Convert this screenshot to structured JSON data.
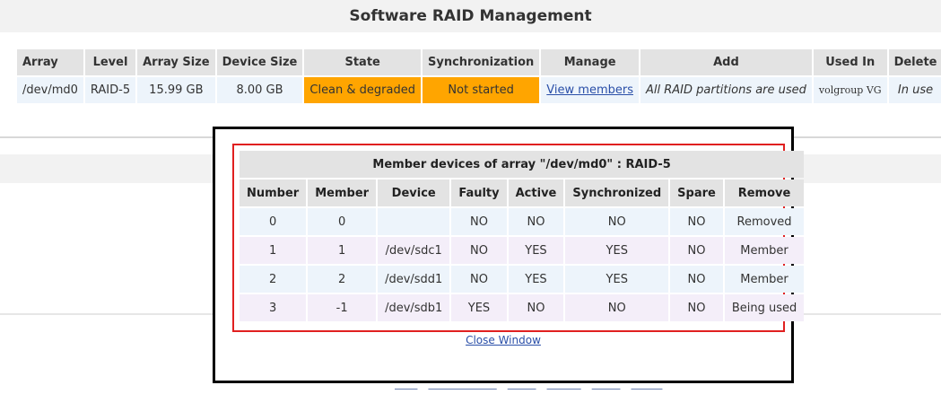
{
  "page": {
    "title": "Software RAID Management"
  },
  "raid_table": {
    "headers": [
      "Array",
      "Level",
      "Array Size",
      "Device Size",
      "State",
      "Synchronization",
      "Manage",
      "Add",
      "Used In",
      "Delete"
    ],
    "row": {
      "array": "/dev/md0",
      "level": "RAID-5",
      "array_size": "15.99 GB",
      "device_size": "8.00 GB",
      "state": "Clean & degraded",
      "synchronization": "Not started",
      "manage_link": "View members",
      "add": "All RAID partitions are used",
      "used_in": "volgroup VG",
      "delete": "In use"
    },
    "colors": {
      "state_bg": "#ffa500",
      "sync_bg": "#ffa500"
    }
  },
  "popup": {
    "caption": "Member devices of array \"/dev/md0\" : RAID-5",
    "headers": [
      "Number",
      "Member",
      "Device",
      "Faulty",
      "Active",
      "Synchronized",
      "Spare",
      "Remove"
    ],
    "rows": [
      {
        "number": "0",
        "member": "0",
        "device": "",
        "faulty": "NO",
        "active": "NO",
        "synchronized": "NO",
        "spare": "NO",
        "remove": "Removed"
      },
      {
        "number": "1",
        "member": "1",
        "device": "/dev/sdc1",
        "faulty": "NO",
        "active": "YES",
        "synchronized": "YES",
        "spare": "NO",
        "remove": "Member"
      },
      {
        "number": "2",
        "member": "2",
        "device": "/dev/sdd1",
        "faulty": "NO",
        "active": "YES",
        "synchronized": "YES",
        "spare": "NO",
        "remove": "Member"
      },
      {
        "number": "3",
        "member": "-1",
        "device": "/dev/sdb1",
        "faulty": "YES",
        "active": "NO",
        "synchronized": "NO",
        "spare": "NO",
        "remove": "Being used"
      }
    ],
    "close_link": "Close Window"
  }
}
